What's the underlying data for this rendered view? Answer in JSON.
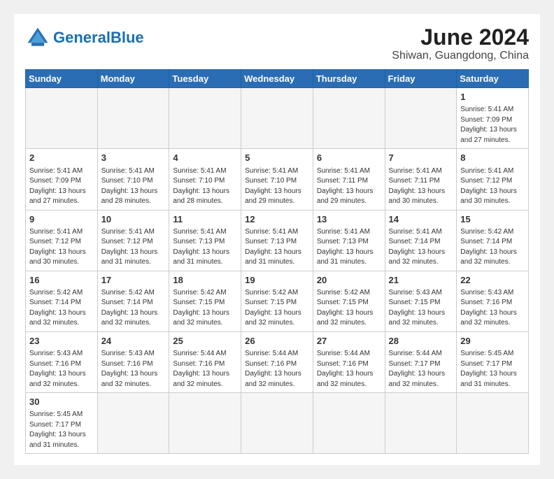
{
  "header": {
    "logo_general": "General",
    "logo_blue": "Blue",
    "title": "June 2024",
    "subtitle": "Shiwan, Guangdong, China"
  },
  "weekdays": [
    "Sunday",
    "Monday",
    "Tuesday",
    "Wednesday",
    "Thursday",
    "Friday",
    "Saturday"
  ],
  "weeks": [
    [
      {
        "day": "",
        "info": ""
      },
      {
        "day": "",
        "info": ""
      },
      {
        "day": "",
        "info": ""
      },
      {
        "day": "",
        "info": ""
      },
      {
        "day": "",
        "info": ""
      },
      {
        "day": "",
        "info": ""
      },
      {
        "day": "1",
        "info": "Sunrise: 5:41 AM\nSunset: 7:09 PM\nDaylight: 13 hours and 27 minutes."
      }
    ],
    [
      {
        "day": "2",
        "info": "Sunrise: 5:41 AM\nSunset: 7:09 PM\nDaylight: 13 hours and 27 minutes."
      },
      {
        "day": "3",
        "info": "Sunrise: 5:41 AM\nSunset: 7:10 PM\nDaylight: 13 hours and 28 minutes."
      },
      {
        "day": "4",
        "info": "Sunrise: 5:41 AM\nSunset: 7:10 PM\nDaylight: 13 hours and 28 minutes."
      },
      {
        "day": "5",
        "info": "Sunrise: 5:41 AM\nSunset: 7:10 PM\nDaylight: 13 hours and 29 minutes."
      },
      {
        "day": "6",
        "info": "Sunrise: 5:41 AM\nSunset: 7:11 PM\nDaylight: 13 hours and 29 minutes."
      },
      {
        "day": "7",
        "info": "Sunrise: 5:41 AM\nSunset: 7:11 PM\nDaylight: 13 hours and 30 minutes."
      },
      {
        "day": "8",
        "info": "Sunrise: 5:41 AM\nSunset: 7:12 PM\nDaylight: 13 hours and 30 minutes."
      }
    ],
    [
      {
        "day": "9",
        "info": "Sunrise: 5:41 AM\nSunset: 7:12 PM\nDaylight: 13 hours and 30 minutes."
      },
      {
        "day": "10",
        "info": "Sunrise: 5:41 AM\nSunset: 7:12 PM\nDaylight: 13 hours and 31 minutes."
      },
      {
        "day": "11",
        "info": "Sunrise: 5:41 AM\nSunset: 7:13 PM\nDaylight: 13 hours and 31 minutes."
      },
      {
        "day": "12",
        "info": "Sunrise: 5:41 AM\nSunset: 7:13 PM\nDaylight: 13 hours and 31 minutes."
      },
      {
        "day": "13",
        "info": "Sunrise: 5:41 AM\nSunset: 7:13 PM\nDaylight: 13 hours and 31 minutes."
      },
      {
        "day": "14",
        "info": "Sunrise: 5:41 AM\nSunset: 7:14 PM\nDaylight: 13 hours and 32 minutes."
      },
      {
        "day": "15",
        "info": "Sunrise: 5:42 AM\nSunset: 7:14 PM\nDaylight: 13 hours and 32 minutes."
      }
    ],
    [
      {
        "day": "16",
        "info": "Sunrise: 5:42 AM\nSunset: 7:14 PM\nDaylight: 13 hours and 32 minutes."
      },
      {
        "day": "17",
        "info": "Sunrise: 5:42 AM\nSunset: 7:14 PM\nDaylight: 13 hours and 32 minutes."
      },
      {
        "day": "18",
        "info": "Sunrise: 5:42 AM\nSunset: 7:15 PM\nDaylight: 13 hours and 32 minutes."
      },
      {
        "day": "19",
        "info": "Sunrise: 5:42 AM\nSunset: 7:15 PM\nDaylight: 13 hours and 32 minutes."
      },
      {
        "day": "20",
        "info": "Sunrise: 5:42 AM\nSunset: 7:15 PM\nDaylight: 13 hours and 32 minutes."
      },
      {
        "day": "21",
        "info": "Sunrise: 5:43 AM\nSunset: 7:15 PM\nDaylight: 13 hours and 32 minutes."
      },
      {
        "day": "22",
        "info": "Sunrise: 5:43 AM\nSunset: 7:16 PM\nDaylight: 13 hours and 32 minutes."
      }
    ],
    [
      {
        "day": "23",
        "info": "Sunrise: 5:43 AM\nSunset: 7:16 PM\nDaylight: 13 hours and 32 minutes."
      },
      {
        "day": "24",
        "info": "Sunrise: 5:43 AM\nSunset: 7:16 PM\nDaylight: 13 hours and 32 minutes."
      },
      {
        "day": "25",
        "info": "Sunrise: 5:44 AM\nSunset: 7:16 PM\nDaylight: 13 hours and 32 minutes."
      },
      {
        "day": "26",
        "info": "Sunrise: 5:44 AM\nSunset: 7:16 PM\nDaylight: 13 hours and 32 minutes."
      },
      {
        "day": "27",
        "info": "Sunrise: 5:44 AM\nSunset: 7:16 PM\nDaylight: 13 hours and 32 minutes."
      },
      {
        "day": "28",
        "info": "Sunrise: 5:44 AM\nSunset: 7:17 PM\nDaylight: 13 hours and 32 minutes."
      },
      {
        "day": "29",
        "info": "Sunrise: 5:45 AM\nSunset: 7:17 PM\nDaylight: 13 hours and 31 minutes."
      }
    ],
    [
      {
        "day": "30",
        "info": "Sunrise: 5:45 AM\nSunset: 7:17 PM\nDaylight: 13 hours and 31 minutes."
      },
      {
        "day": "",
        "info": ""
      },
      {
        "day": "",
        "info": ""
      },
      {
        "day": "",
        "info": ""
      },
      {
        "day": "",
        "info": ""
      },
      {
        "day": "",
        "info": ""
      },
      {
        "day": "",
        "info": ""
      }
    ]
  ]
}
